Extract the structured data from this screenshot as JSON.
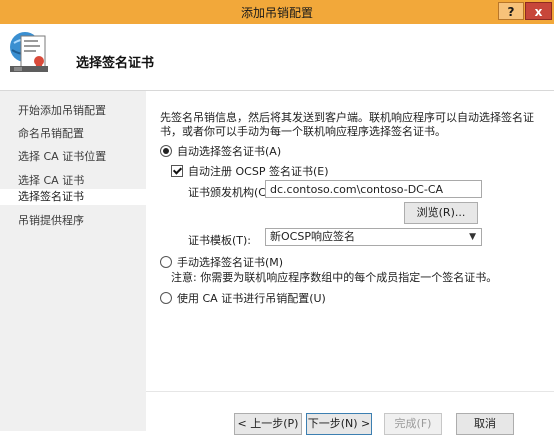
{
  "window": {
    "title": "添加吊销配置",
    "help_label": "?",
    "close_label": "x"
  },
  "header": {
    "title": "选择签名证书",
    "icon": "certificate-wizard-icon"
  },
  "sidebar": {
    "items": [
      {
        "label": "开始添加吊销配置"
      },
      {
        "label": "命名吊销配置"
      },
      {
        "label": "选择 CA 证书位置"
      },
      {
        "label": "选择 CA 证书"
      },
      {
        "label": "选择签名证书"
      },
      {
        "label": "吊销提供程序"
      }
    ],
    "current_index": 4
  },
  "main": {
    "description": "先签名吊销信息，然后将其发送到客户端。联机响应程序可以自动选择签名证书，或者你可以手动为每一个联机响应程序选择签名证书。",
    "auto_select_label": "自动选择签名证书(A)",
    "auto_enroll_label": "自动注册 OCSP 签名证书(E)",
    "issuer_label": "证书颁发机构(C):",
    "issuer_value": "dc.contoso.com\\contoso-DC-CA",
    "browse_label": "浏览(R)...",
    "template_label": "证书模板(T):",
    "template_value": "新OCSP响应签名",
    "manual_select_label": "手动选择签名证书(M)",
    "manual_note": "注意: 你需要为联机响应程序数组中的每个成员指定一个签名证书。",
    "use_ca_label": "使用 CA 证书进行吊销配置(U)"
  },
  "state": {
    "selected_option": "auto_select",
    "auto_enroll_checked": true
  },
  "footer": {
    "back_label": "< 上一步(P)",
    "next_label": "下一步(N) >",
    "finish_label": "完成(F)",
    "cancel_label": "取消"
  },
  "colors": {
    "titlebar": "#f2a83a",
    "sidebar_bg": "#f0f0f0",
    "close_button": "#c7463a"
  }
}
